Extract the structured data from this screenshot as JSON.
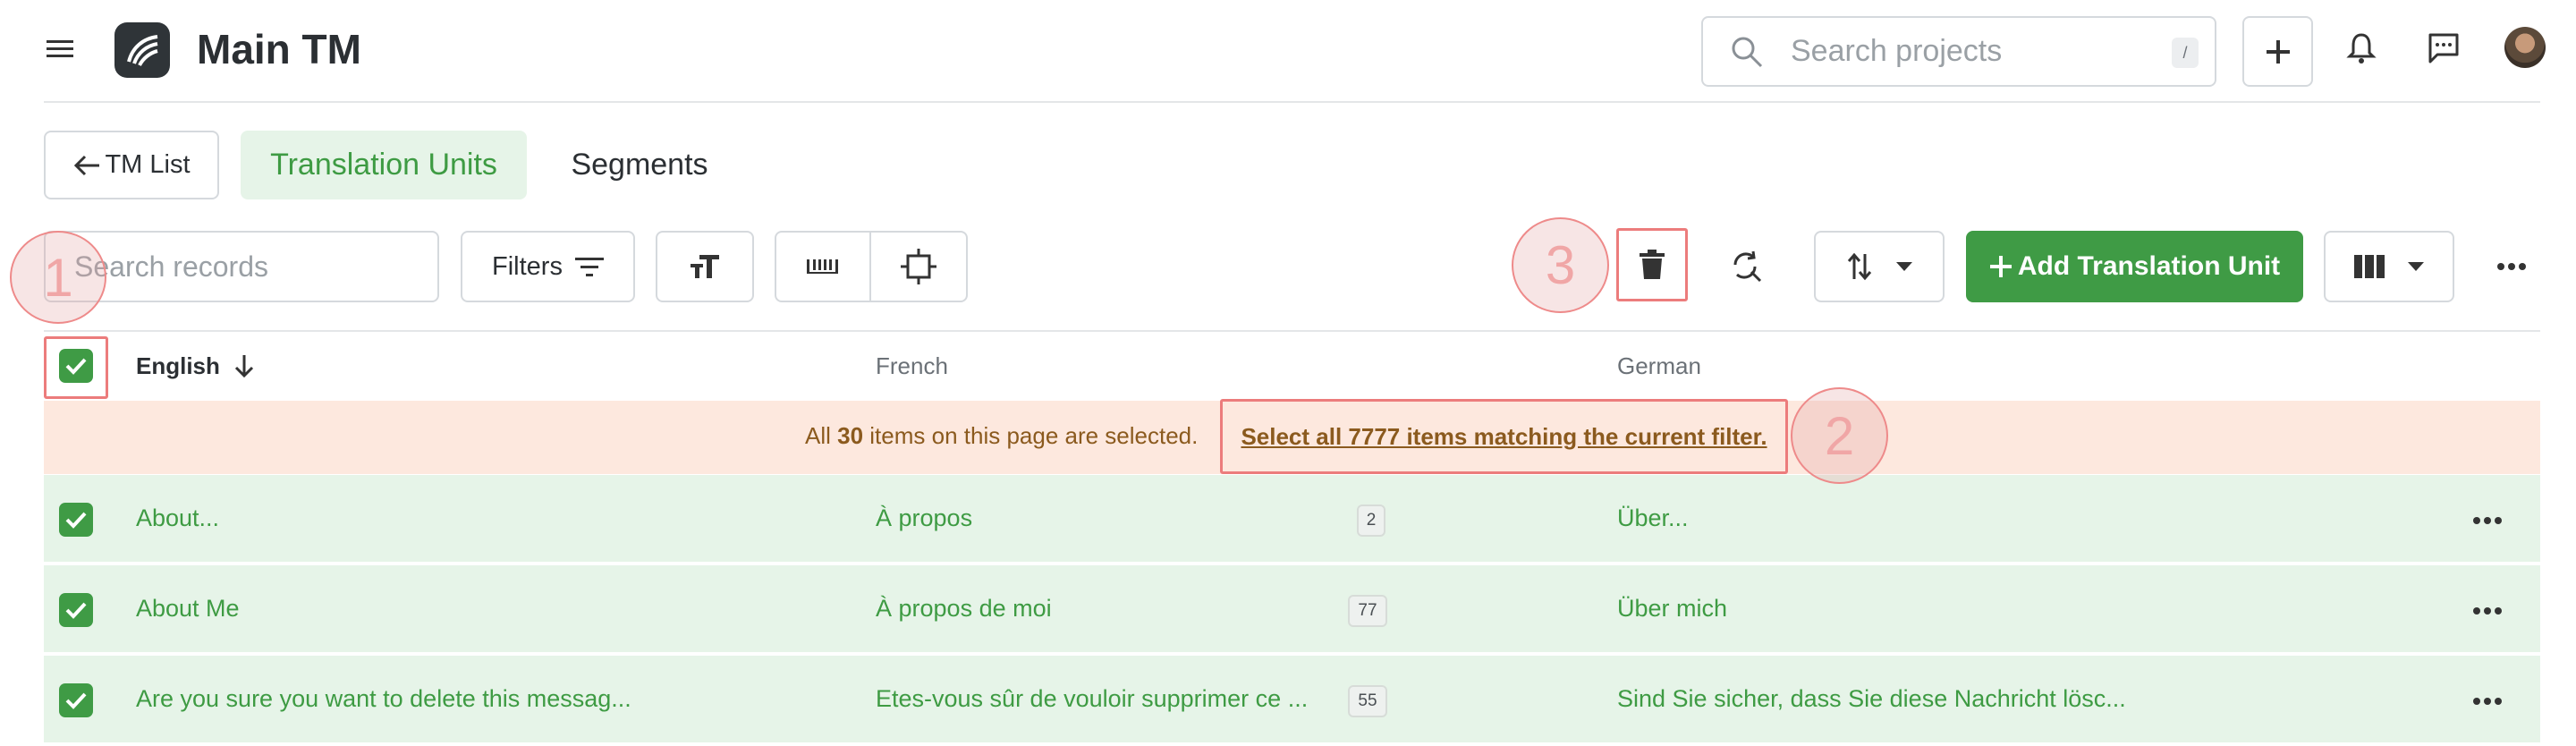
{
  "app": {
    "title": "Main TM"
  },
  "search": {
    "placeholder": "Search projects",
    "shortcut": "/"
  },
  "nav": {
    "back_label": "TM List",
    "tabs": [
      {
        "label": "Translation Units"
      },
      {
        "label": "Segments"
      }
    ]
  },
  "toolbar": {
    "search_placeholder": "Search records",
    "filters_label": "Filters",
    "add_label": "Add Translation Unit"
  },
  "table": {
    "columns": [
      {
        "label": "English"
      },
      {
        "label": "French"
      },
      {
        "label": "German"
      }
    ],
    "selection_banner": {
      "text_prefix": "All ",
      "count": "30",
      "text_suffix": " items on this page are selected.",
      "link": "Select all 7777 items matching the current filter."
    },
    "rows": [
      {
        "english": "About...",
        "french": "À propos",
        "count": "2",
        "german": "Über..."
      },
      {
        "english": "About Me",
        "french": "À propos de moi",
        "count": "77",
        "german": "Über mich"
      },
      {
        "english": "Are you sure you want to delete this messag...",
        "french": "Etes-vous sûr de vouloir supprimer ce ...",
        "count": "55",
        "german": "Sind Sie sicher, dass Sie diese Nachricht lösc..."
      }
    ]
  },
  "markers": [
    "1",
    "2",
    "3"
  ],
  "colors": {
    "accent_green": "#3f9b45",
    "selected_row_bg": "#e6f4e8",
    "banner_bg": "#fde8de",
    "banner_text": "#8b5a1e",
    "highlight_red": "#ec7c7c"
  }
}
